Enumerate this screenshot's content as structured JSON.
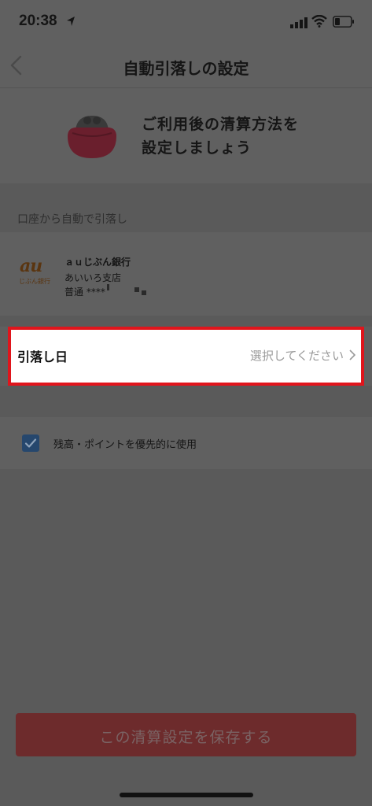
{
  "status_bar": {
    "time": "20:38",
    "icons": [
      "location-arrow-icon",
      "signal-icon",
      "wifi-icon",
      "battery-icon"
    ]
  },
  "nav": {
    "title": "自動引落しの設定",
    "back_icon": "chevron-left-icon"
  },
  "hero": {
    "icon": "purse-icon",
    "text": "ご利用後の清算方法を\n設定しましょう"
  },
  "section": {
    "label": "口座から自動で引落し"
  },
  "bank": {
    "logo_text": "au",
    "logo_sub": "じぶん銀行",
    "name": "ａｕじぶん銀行",
    "branch": "あいいろ支店",
    "account": "普通 ****"
  },
  "withdrawal_date": {
    "label": "引落し日",
    "value": "選択してください"
  },
  "option": {
    "label": "残高・ポイントを優先的に使用",
    "checked": true
  },
  "save_button": {
    "label": "この清算設定を保存する"
  },
  "colors": {
    "overlay_gray": "#5f5f5f",
    "highlight_red": "#e0151c",
    "button_red": "#6d2b2c",
    "checkbox_blue": "#26476d"
  }
}
